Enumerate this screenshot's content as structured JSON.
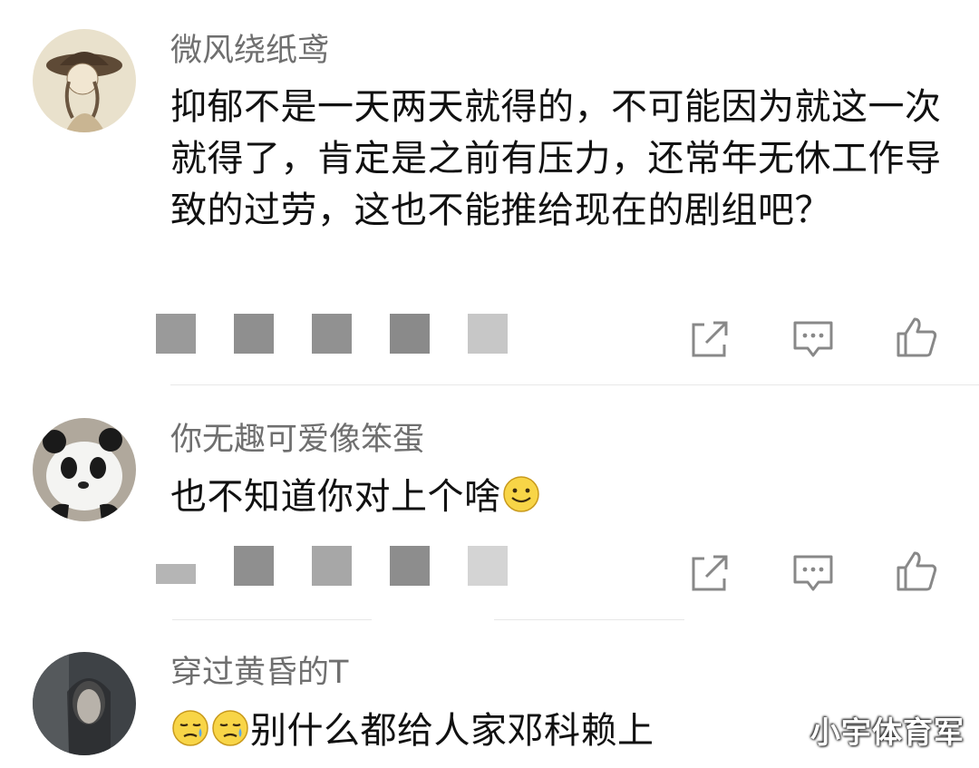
{
  "comments": [
    {
      "username": "微风绕纸鸢",
      "text": "抑郁不是一天两天就得的，不可能因为就这一次就得了，肯定是之前有压力，还常年无休工作导致的过劳，这也不能推给现在的剧组吧？",
      "avatar_icon": "avatar-girl-hat-sketch",
      "actions": [
        "share-icon",
        "reply-icon",
        "like-icon"
      ]
    },
    {
      "username": "你无趣可爱像笨蛋",
      "text": "也不知道你对上个啥",
      "emoji_after": "smile-emoji",
      "avatar_icon": "avatar-panda",
      "actions": [
        "share-icon",
        "reply-icon",
        "like-icon"
      ]
    },
    {
      "username": "穿过黄昏的T",
      "emoji_before": [
        "sad-emoji",
        "sad-emoji"
      ],
      "text": "别什么都给人家邓科赖上",
      "avatar_icon": "avatar-dark-portrait"
    }
  ],
  "watermark": "小宇体育军",
  "colors": {
    "username": "#6f6f6f",
    "text": "#111111",
    "icon": "#888888",
    "separator": "#e8e8e8"
  }
}
